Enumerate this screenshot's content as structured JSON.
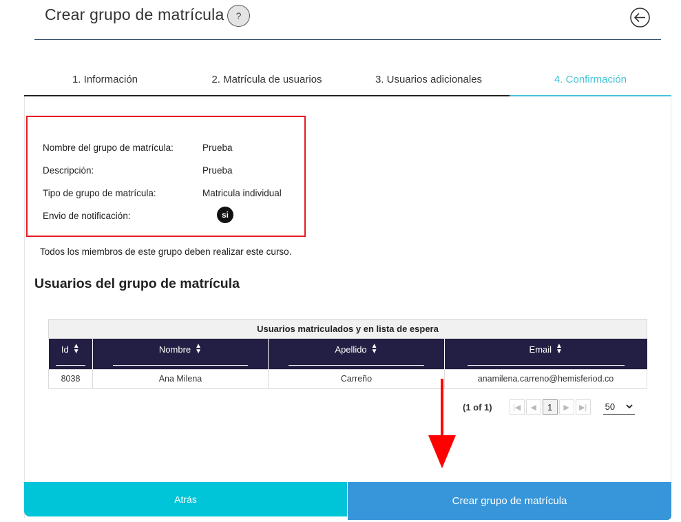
{
  "header": {
    "title": "Crear grupo de matrícula",
    "help_label": "?"
  },
  "steps": [
    {
      "label": "1. Información"
    },
    {
      "label": "2. Matrícula de usuarios"
    },
    {
      "label": "3. Usuarios adicionales"
    },
    {
      "label": "4. Confirmación",
      "active": true
    }
  ],
  "summary": {
    "name_label": "Nombre del grupo de matrícula:",
    "name_value": "Prueba",
    "description_label": "Descripción:",
    "description_value": "Prueba",
    "type_label": "Tipo de grupo de matrícula:",
    "type_value": "Matricula individual",
    "notification_label": "Envio de notificación:",
    "notification_value": "si"
  },
  "note": "Todos los miembros de este grupo deben realizar este curso.",
  "users_section": {
    "title": "Usuarios del grupo de matrícula",
    "table_caption": "Usuarios matriculados y en lista de espera",
    "columns": [
      "Id",
      "Nombre",
      "Apellido",
      "Email"
    ],
    "rows": [
      [
        "8038",
        "Ana Milena",
        "Carreño",
        "anamilena.carreno@hemisferiod.co"
      ]
    ]
  },
  "pagination": {
    "count": "(1 of 1)",
    "current_page": "1",
    "rows_per_page": "50"
  },
  "footer": {
    "back_label": "Atrás",
    "create_label": "Crear grupo de matrícula"
  },
  "colors": {
    "accent": "#45c3d5",
    "back_button": "#00c4d7",
    "create_button": "#3796d9",
    "table_header": "#231f44",
    "highlight_border": "#e51c23",
    "arrow": "#ff0000"
  }
}
